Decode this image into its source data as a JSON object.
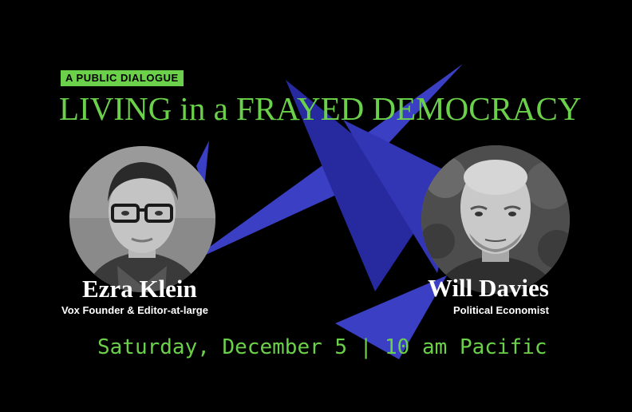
{
  "event": {
    "kicker": "A PUBLIC DIALOGUE",
    "title": "LIVING in a FRAYED DEMOCRACY",
    "date_line": "Saturday, December 5 | 10 am Pacific"
  },
  "speakers": [
    {
      "name": "Ezra Klein",
      "role": "Vox Founder & Editor-at-large"
    },
    {
      "name": "Will Davies",
      "role": "Political Economist"
    }
  ],
  "colors": {
    "background": "#000000",
    "accent_green": "#6bd14a",
    "shape_blue": "#3b3fc4",
    "shape_blue_dark": "#1f2496",
    "text_white": "#ffffff"
  }
}
